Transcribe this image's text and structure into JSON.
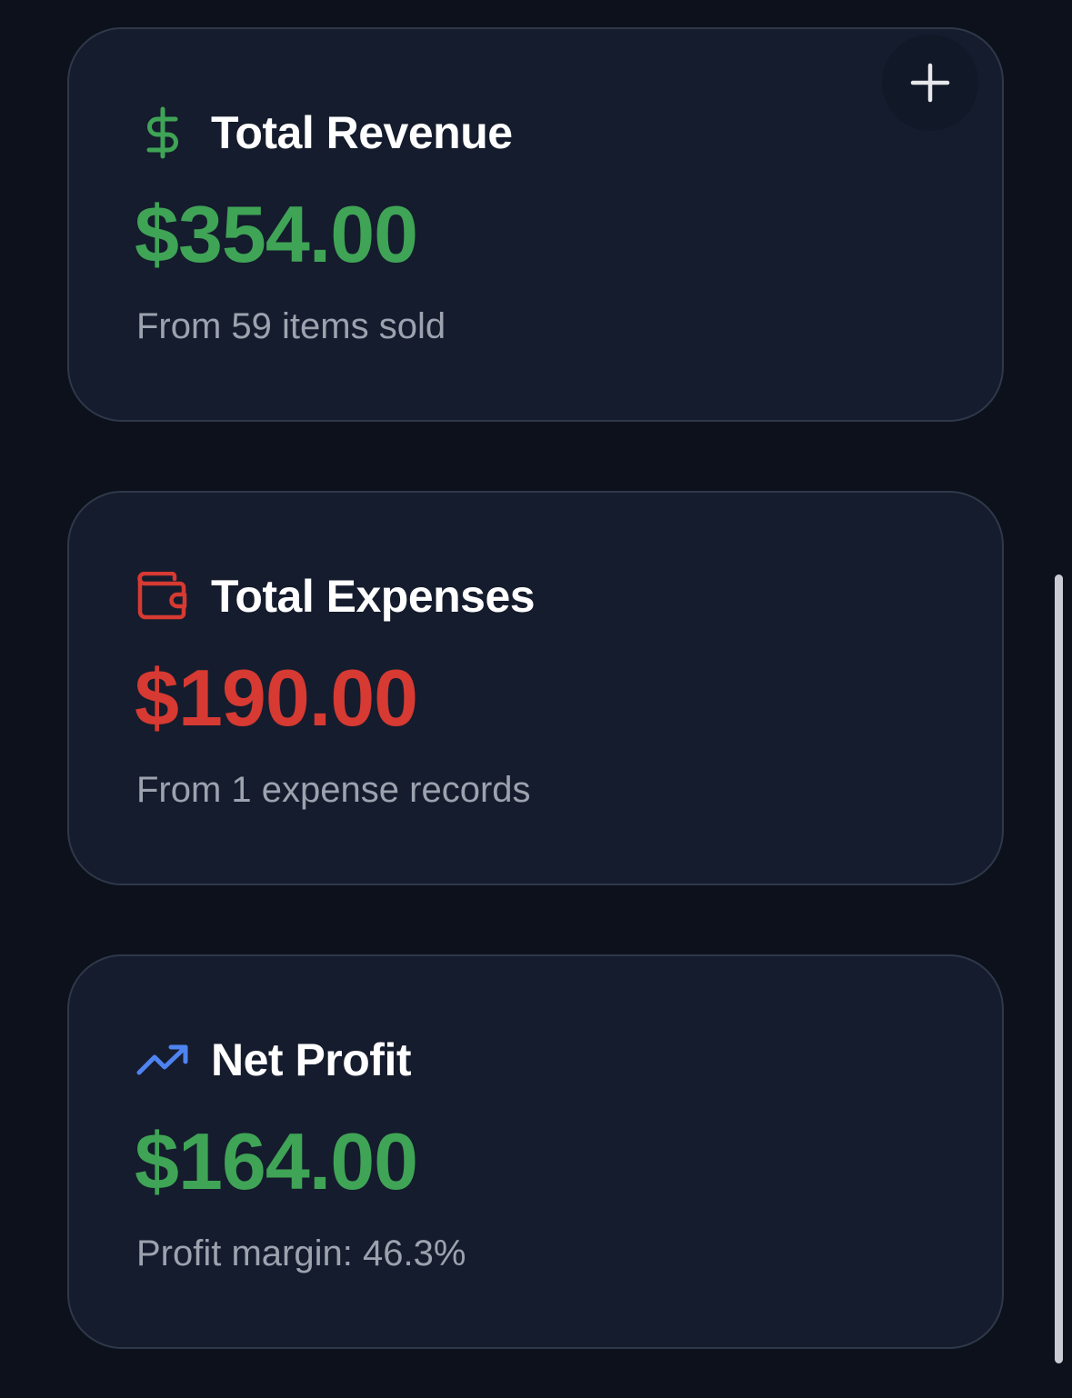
{
  "colors": {
    "background": "#0c111c",
    "card": "#151c2d",
    "card_border": "#2f3849",
    "positive": "#3fa456",
    "negative": "#d63a32",
    "accent": "#4e83f0",
    "subtitle": "#9ca3af"
  },
  "fab": {
    "icon": "plus-icon"
  },
  "cards": [
    {
      "icon": "dollar-sign-icon",
      "title": "Total Revenue",
      "value": "$354.00",
      "subtitle": "From 59 items sold"
    },
    {
      "icon": "wallet-icon",
      "title": "Total Expenses",
      "value": "$190.00",
      "subtitle": "From 1 expense records"
    },
    {
      "icon": "trending-up-icon",
      "title": "Net Profit",
      "value": "$164.00",
      "subtitle": "Profit margin: 46.3%"
    }
  ]
}
